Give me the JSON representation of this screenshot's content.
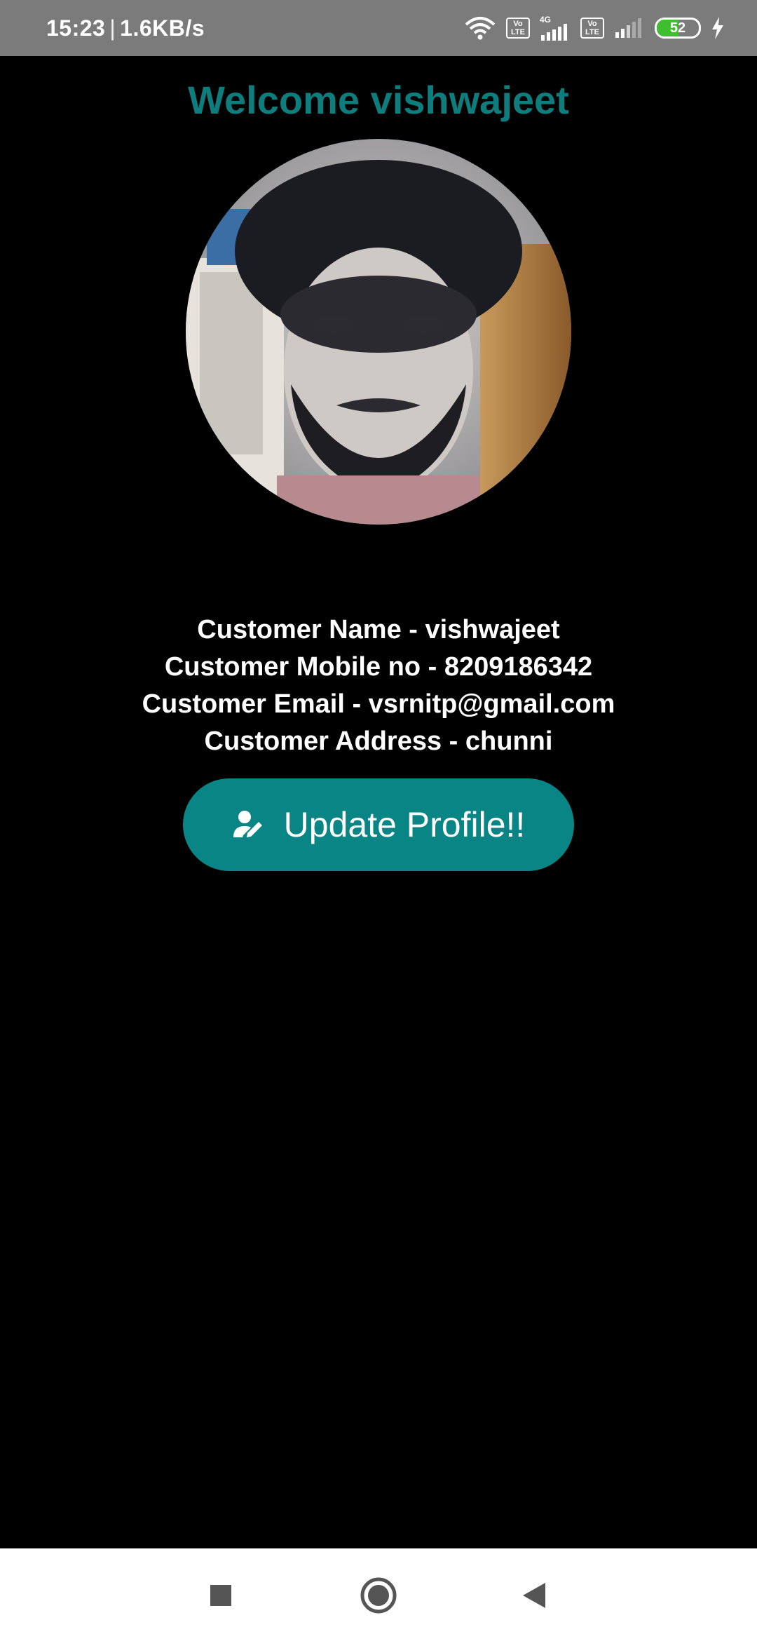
{
  "status_bar": {
    "time": "15:23",
    "network_speed": "1.6KB/s",
    "battery_level": 52,
    "battery_label": "52",
    "sim1_badge_top": "Vo",
    "sim1_badge_bottom": "LTE",
    "sim1_network": "4G",
    "sim2_badge_top": "Vo",
    "sim2_badge_bottom": "LTE",
    "icons": [
      "wifi-icon",
      "signal-icon",
      "signal-icon",
      "battery-icon",
      "charging-icon"
    ]
  },
  "profile": {
    "welcome_text": "Welcome vishwajeet",
    "name_line": "Customer Name - vishwajeet",
    "mobile_line": "Customer Mobile no - 8209186342",
    "email_line": "Customer Email - vsrnitp@gmail.com",
    "address_line": "Customer Address - chunni",
    "update_button_label": "Update Profile!!",
    "update_button_icon": "edit-person-icon"
  },
  "colors": {
    "accent": "#0e7d7d",
    "button": "#0a8585",
    "background": "#000000",
    "status_bar": "#7b7b7b"
  },
  "nav_bar": {
    "icons": [
      "recents-square-icon",
      "home-circle-icon",
      "back-triangle-icon"
    ]
  }
}
